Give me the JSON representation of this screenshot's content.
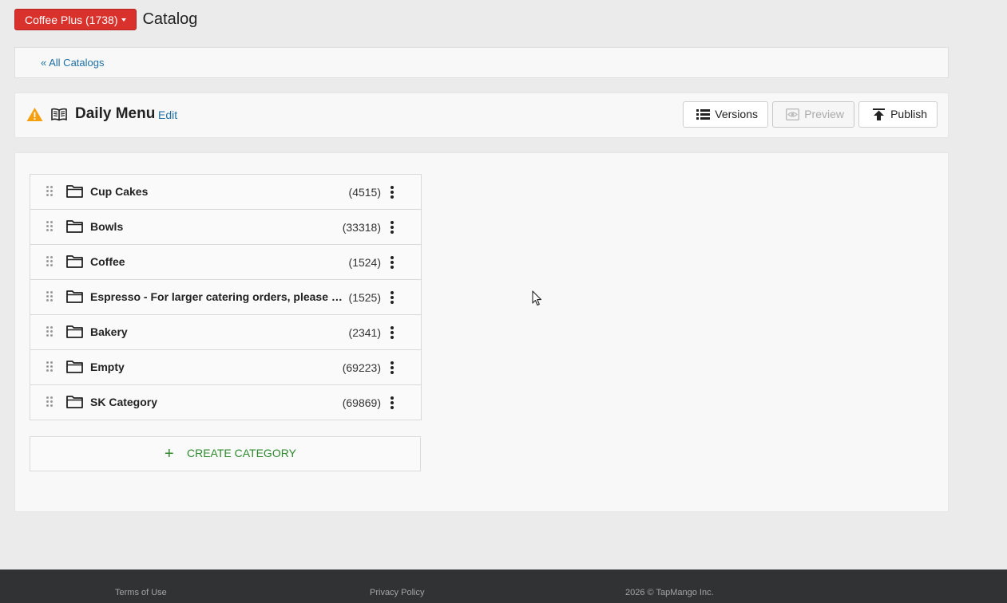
{
  "header": {
    "store_label": "Coffee Plus (1738)",
    "page_title": "Catalog"
  },
  "breadcrumb": {
    "back_link": "« All Catalogs"
  },
  "menu": {
    "name": "Daily Menu",
    "edit_label": "Edit",
    "actions": {
      "versions": "Versions",
      "preview": "Preview",
      "publish": "Publish"
    }
  },
  "categories": [
    {
      "name": "Cup Cakes",
      "count": "(4515)"
    },
    {
      "name": "Bowls",
      "count": "(33318)"
    },
    {
      "name": "Coffee",
      "count": "(1524)"
    },
    {
      "name": "Espresso - For larger catering orders, please call us!",
      "count": "(1525)"
    },
    {
      "name": "Bakery",
      "count": "(2341)"
    },
    {
      "name": "Empty",
      "count": "(69223)"
    },
    {
      "name": "SK Category",
      "count": "(69869)"
    }
  ],
  "create_category": {
    "icon": "+",
    "label": "CREATE CATEGORY"
  },
  "footer": {
    "terms": "Terms of Use",
    "privacy": "Privacy Policy",
    "copyright": "2026 © TapMango Inc."
  },
  "colors": {
    "brand_red": "#d9312b",
    "link_blue": "#1d6fa5",
    "create_green": "#2f8a2f",
    "warning_orange": "#f5a00f",
    "footer_bg": "#303233"
  }
}
